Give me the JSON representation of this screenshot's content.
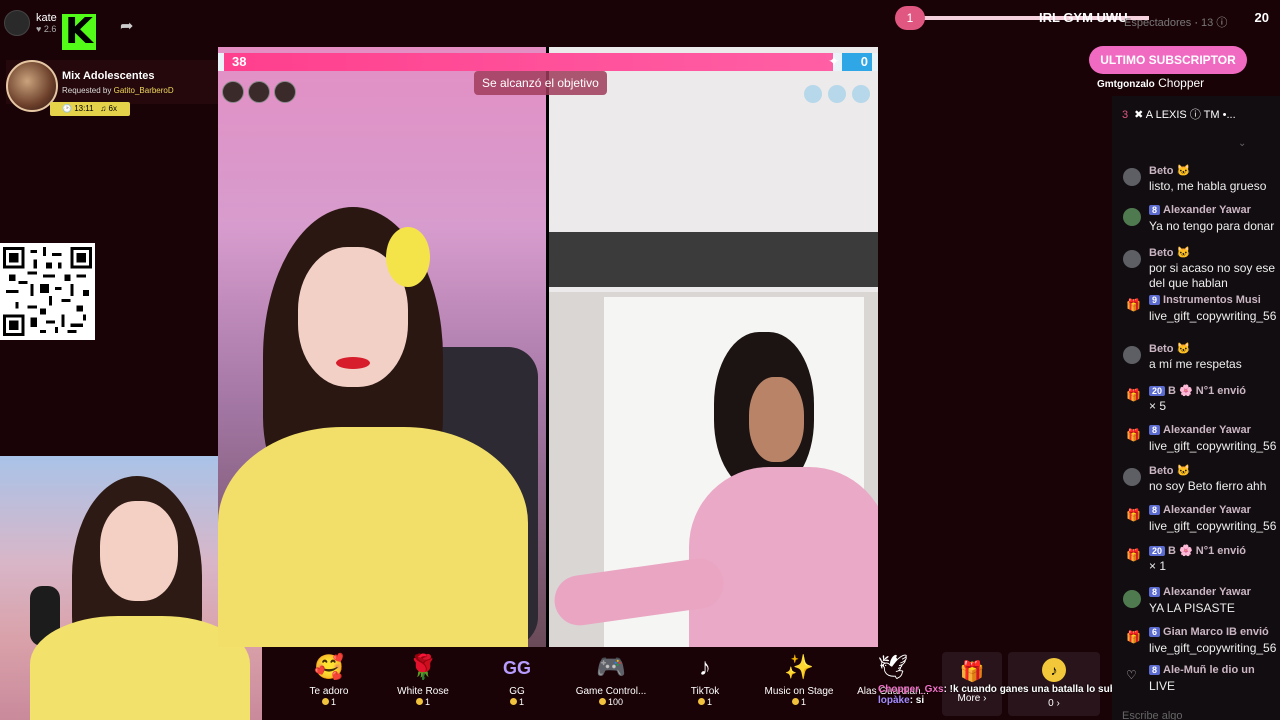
{
  "host": {
    "name": "kate",
    "likes": "2.6"
  },
  "music": {
    "title": "Mix Adolescentes",
    "requested_prefix": "Requested by",
    "requested_by": "Gatito_BarberoD",
    "time": "13:11",
    "extra": "6x"
  },
  "battle": {
    "left_score": "38",
    "right_score": "0",
    "goal_text": "Se alcanzó el objetivo"
  },
  "gifts": [
    {
      "name": "Te adoro",
      "price": "1",
      "icon": "heart-face-icon"
    },
    {
      "name": "White Rose",
      "price": "1",
      "icon": "rose-icon"
    },
    {
      "name": "GG",
      "price": "1",
      "icon": "gg-icon"
    },
    {
      "name": "Game Control...",
      "price": "100",
      "icon": "gamepad-icon"
    },
    {
      "name": "TikTok",
      "price": "1",
      "icon": "tiktok-icon"
    },
    {
      "name": "Music on Stage",
      "price": "1",
      "icon": "music-stage-icon"
    },
    {
      "name": "Alas Guardian...",
      "price": "",
      "icon": "wings-icon"
    }
  ],
  "more": {
    "label": "More ›"
  },
  "tokens": {
    "value": "0 ›"
  },
  "overlay_chat": [
    {
      "user": "Chopper_Gxs",
      "text": ": !k cuando ganes una batalla lo subes"
    },
    {
      "user": "lopàke",
      "text": ": si"
    }
  ],
  "banner": {
    "rank": "1",
    "title": "IRL GYM UWU",
    "count": "20"
  },
  "viewers": {
    "label": "Espectadores",
    "count": "13"
  },
  "subscriber": {
    "button": "ULTIMO SUBSCRIPTOR",
    "user": "Gmtgonzalo",
    "name": "Chopper"
  },
  "chat": {
    "top_user": {
      "rank": "3",
      "name": "✖ A LEXIS ⓘ TM •..."
    },
    "placeholder": "Escribe algo",
    "messages": [
      {
        "user": "Beto 🐱",
        "level": "",
        "text": "listo, me habla grueso",
        "text2": "",
        "type": "user",
        "avatar": "grey"
      },
      {
        "user": "Alexander Yawar",
        "level": "8",
        "text": "Ya no tengo para donar",
        "text2": "",
        "type": "user",
        "avatar": "green"
      },
      {
        "user": "Beto 🐱",
        "level": "",
        "text": "por si acaso no soy ese",
        "text2": "del que hablan",
        "type": "user",
        "avatar": "grey"
      },
      {
        "user": "Instrumentos Musi",
        "level": "9",
        "text": "live_gift_copywriting_56",
        "text2": "",
        "type": "gift",
        "avatar": ""
      },
      {
        "user": "Beto 🐱",
        "level": "",
        "text": "a mí me respetas",
        "text2": "",
        "type": "user",
        "avatar": "grey"
      },
      {
        "user": "B 🌸 N°1 envió",
        "level": "20",
        "text": "× 5",
        "text2": "",
        "type": "gift",
        "avatar": ""
      },
      {
        "user": "Alexander Yawar",
        "level": "8",
        "text": "live_gift_copywriting_56",
        "text2": "",
        "type": "gift",
        "avatar": ""
      },
      {
        "user": "Beto 🐱",
        "level": "",
        "text": "no soy Beto fierro ahh",
        "text2": "",
        "type": "user",
        "avatar": "grey"
      },
      {
        "user": "Alexander Yawar",
        "level": "8",
        "text": "live_gift_copywriting_56",
        "text2": "",
        "type": "gift",
        "avatar": ""
      },
      {
        "user": "B 🌸 N°1 envió",
        "level": "20",
        "text": "× 1",
        "text2": "",
        "type": "gift",
        "avatar": ""
      },
      {
        "user": "Alexander Yawar",
        "level": "8",
        "text": "YA LA PISASTE",
        "text2": "",
        "type": "user",
        "avatar": "green"
      },
      {
        "user": "Gian Marco IB envió",
        "level": "6",
        "text": "live_gift_copywriting_56",
        "text2": "",
        "type": "gift",
        "avatar": ""
      },
      {
        "user": "Ale-Muñ le dio un",
        "level": "8",
        "text": "LIVE",
        "text2": "",
        "type": "like",
        "avatar": ""
      }
    ]
  }
}
